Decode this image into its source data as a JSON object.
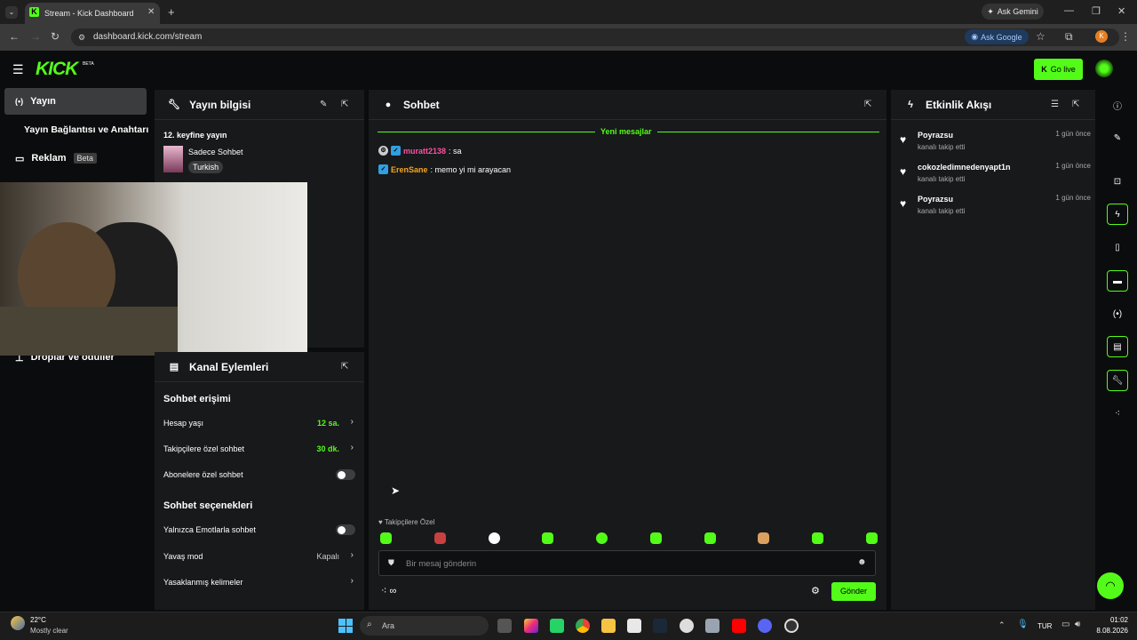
{
  "browser": {
    "tab_title": "Stream - Kick Dashboard",
    "tab_close": "✕",
    "new_tab": "+",
    "ask_gemini": "Ask Gemini",
    "url": "dashboard.kick.com/stream",
    "ask_google": "Ask Google",
    "profile_initial": "K"
  },
  "header": {
    "logo": "KICK",
    "logo_badge": "BETA",
    "go_live": "Go live"
  },
  "sidebar": {
    "items": [
      {
        "label": "Yayın"
      },
      {
        "label": "Yayın Bağlantısı ve Anahtarı"
      },
      {
        "label": "Reklam",
        "badge": "Beta"
      },
      {
        "label": "Droplar ve ödüller"
      }
    ]
  },
  "stream_info": {
    "title": "Yayın bilgisi",
    "stream_title": "12. keyfine yayın",
    "category": "Sadece Sohbet",
    "language": "Turkish"
  },
  "channel_actions": {
    "title": "Kanal Eylemleri",
    "chat_access": "Sohbet erişimi",
    "account_age_label": "Hesap yaşı",
    "account_age_value": "12 sa.",
    "followers_only_label": "Takipçilere özel sohbet",
    "followers_only_value": "30 dk.",
    "subscribers_only_label": "Abonelere özel sohbet",
    "chat_options": "Sohbet seçenekleri",
    "emotes_only_label": "Yalnızca Emotlarla sohbet",
    "slow_mode_label": "Yavaş mod",
    "slow_mode_value": "Kapalı",
    "banned_words_label": "Yasaklanmış kelimeler"
  },
  "chat": {
    "title": "Sohbet",
    "new_messages": "Yeni mesajlar",
    "messages": [
      {
        "user": "muratt2138",
        "text": ": sa",
        "color": "#ff4fa3"
      },
      {
        "user": "ErenSane",
        "text": ": memo yi mi arayacan",
        "color": "#f5a623"
      }
    ],
    "emote_section": "Takipçilere Özel",
    "input_placeholder": "Bir mesaj gönderin",
    "send": "Gönder",
    "points": "∞"
  },
  "activity": {
    "title": "Etkinlik Akışı",
    "items": [
      {
        "name": "Poyrazsu",
        "sub": "kanalı takip etti",
        "time": "1 gün önce"
      },
      {
        "name": "cokozledimnedenyapt1n",
        "sub": "kanalı takip etti",
        "time": "1 gün önce"
      },
      {
        "name": "Poyrazsu",
        "sub": "kanalı takip etti",
        "time": "1 gün önce"
      }
    ]
  },
  "taskbar": {
    "weather_temp": "22°C",
    "weather_desc": "Mostly clear",
    "search": "Ara",
    "lang": "TUR",
    "time": "01:02",
    "date": "8.08.2026"
  },
  "colors": {
    "accent": "#53fc18",
    "panel": "#18191b",
    "bg": "#0b0c0d"
  }
}
